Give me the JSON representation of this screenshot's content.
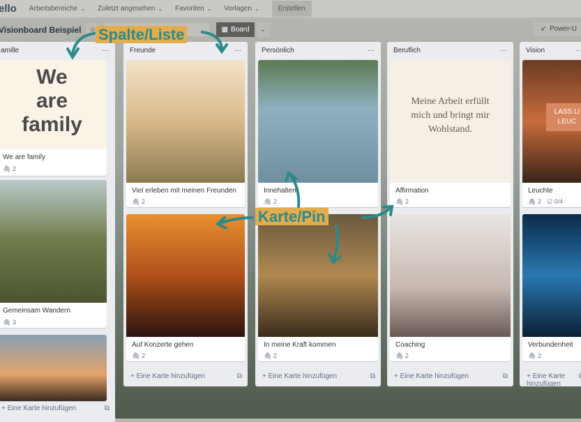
{
  "topbar": {
    "logo": "ello",
    "nav": [
      "Arbeitsbereiche",
      "Zuletzt angesehen",
      "Favoriten",
      "Vorlagen"
    ],
    "create": "Erstellen"
  },
  "boardbar": {
    "title": "Visionboard Beispiel",
    "view": "Board",
    "powerups": "Power-U"
  },
  "annotations": {
    "list": "Spalte/Liste",
    "card": "Karte/Pin",
    "color": "#2d8a8a",
    "label_bg": "#e3ac4d"
  },
  "add_card": "Eine Karte hinzufügen",
  "lists": [
    {
      "name": "amille",
      "cards": [
        {
          "title": "We are family",
          "attachments": "2",
          "image_text": "We are family"
        },
        {
          "title": "Gemeinsam Wandern",
          "attachments": "3"
        },
        {
          "title": ""
        }
      ]
    },
    {
      "name": "Freunde",
      "cards": [
        {
          "title": "Viel erleben mit meinen Freunden",
          "attachments": "2"
        },
        {
          "title": "Auf Konzerte gehen",
          "attachments": "2"
        }
      ]
    },
    {
      "name": "Persönlich",
      "cards": [
        {
          "title": "Innehalten",
          "attachments": "2"
        },
        {
          "title": "In meine Kraft kommen",
          "attachments": "2"
        }
      ]
    },
    {
      "name": "Beruflich",
      "cards": [
        {
          "title": "Affirmation",
          "attachments": "2",
          "image_text": "Meine Arbeit erfüllt mich und bringt mir Wohlstand."
        },
        {
          "title": "Coaching",
          "attachments": "2"
        }
      ]
    },
    {
      "name": "Vision",
      "cards": [
        {
          "title": "Leuchte",
          "attachments": "2",
          "checklist": "0/4",
          "image_text": "LASS LI LEUC"
        },
        {
          "title": "Verbundenheit",
          "attachments": "2"
        }
      ]
    }
  ]
}
